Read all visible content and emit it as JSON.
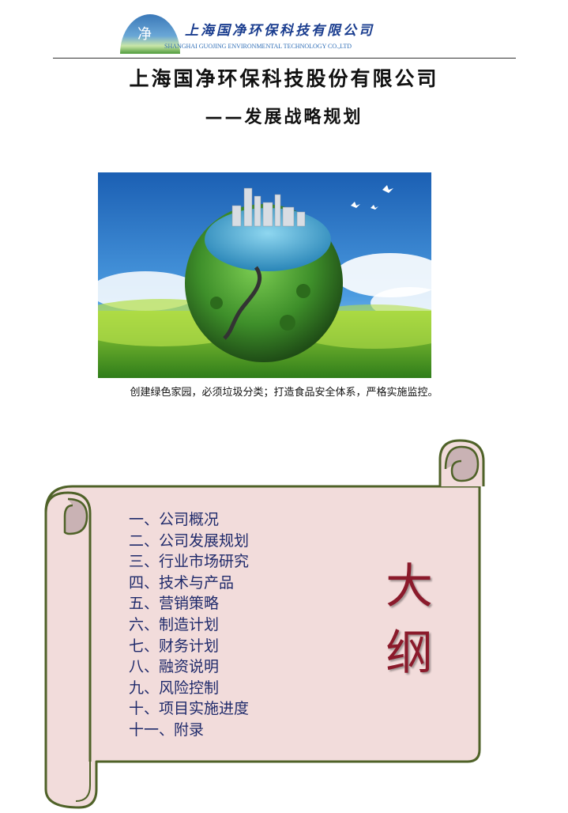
{
  "header": {
    "logo_char": "净",
    "company_cn": "上海国净环保科技有限公司",
    "company_en": "SHANGHAI GUOJING ENVIRONMENTAL TECHNOLOGY CO.,LTD"
  },
  "title": "上海国净环保科技股份有限公司",
  "subtitle": "——发展战略规划",
  "caption": "创建绿色家园，必须垃圾分类；打造食品安全体系，严格实施监控。",
  "outline": {
    "heading_line1": "大",
    "heading_line2": "纲",
    "items": [
      "一、公司概况",
      "二、公司发展规划",
      "三、行业市场研究",
      "四、技术与产品",
      "五、营销策略",
      "六、制造计划",
      "七、财务计划",
      "八、融资说明",
      "九、风险控制",
      "十、项目实施进度",
      "十一、附录"
    ]
  },
  "colors": {
    "scroll_fill": "#f2dcdb",
    "scroll_border": "#4f6228",
    "scroll_curl": "#c9b2b4",
    "outline_text": "#1f2a6b",
    "heading_text": "#8b1a2b",
    "logo_text": "#1a3d8f"
  }
}
